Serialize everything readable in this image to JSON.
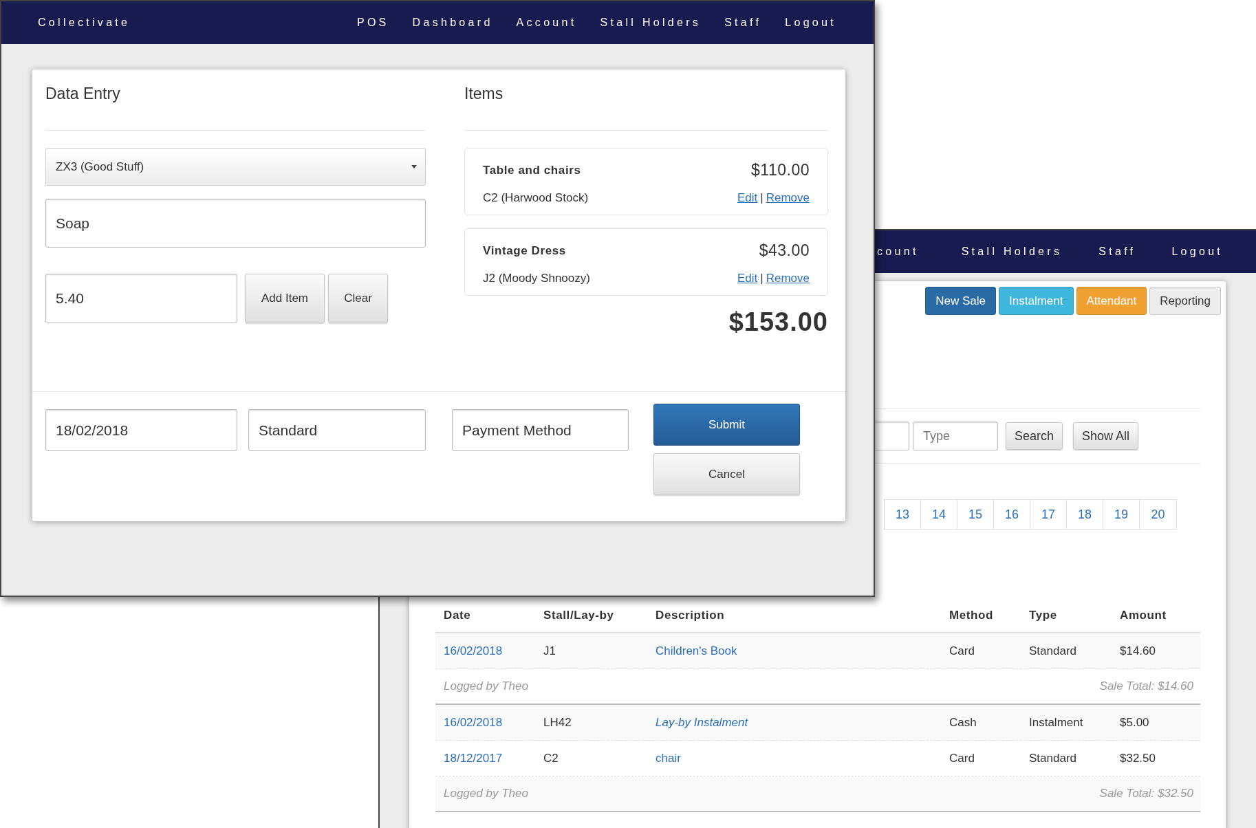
{
  "front_window": {
    "nav": {
      "brand": "Collectivate",
      "links": [
        "POS",
        "Dashboard",
        "Account",
        "Stall Holders",
        "Staff",
        "Logout"
      ]
    },
    "data_entry": {
      "heading": "Data Entry",
      "stall_select": "ZX3 (Good Stuff)",
      "description_value": "Soap",
      "price_value": "5.40",
      "buttons": [
        "Add Item",
        "Clear"
      ]
    },
    "items": {
      "heading": "Items",
      "list": [
        {
          "name": "Table and chairs",
          "price": "$110.00",
          "stall": "C2 (Harwood Stock)",
          "edit": "Edit",
          "separator": "|",
          "remove": "Remove"
        },
        {
          "name": "Vintage Dress",
          "price": "$43.00",
          "stall": "J2 (Moody Shnoozy)",
          "edit": "Edit",
          "separator": "|",
          "remove": "Remove"
        }
      ],
      "total": "$153.00"
    },
    "footer": {
      "date_value": "18/02/2018",
      "type_value": "Standard",
      "payment_value": "Payment Method",
      "submit": "Submit",
      "cancel": "Cancel"
    }
  },
  "back_window": {
    "nav": {
      "links": [
        "count",
        "Stall Holders",
        "Staff",
        "Logout"
      ]
    },
    "mode_buttons": [
      {
        "label": "New Sale",
        "color": "#2a6aa5"
      },
      {
        "label": "Instalment",
        "color": "#3fb6dc"
      },
      {
        "label": "Attendant",
        "color": "#f0a132"
      },
      {
        "label": "Reporting",
        "color": "#ececec"
      }
    ],
    "search": {
      "type_placeholder": "Type",
      "buttons": [
        "Search",
        "Show All"
      ]
    },
    "pagination": [
      "13",
      "14",
      "15",
      "16",
      "17",
      "18",
      "19",
      "20"
    ],
    "table": {
      "columns": [
        "Date",
        "Stall/Lay-by",
        "Description",
        "Method",
        "Type",
        "Amount"
      ],
      "rows": [
        {
          "kind": "sale",
          "date": "16/02/2018",
          "stall": "J1",
          "description": "Children's Book",
          "italic": false,
          "method": "Card",
          "type": "Standard",
          "amount": "$14.60"
        },
        {
          "kind": "summary",
          "logged": "Logged by Theo",
          "total": "Sale Total: $14.60"
        },
        {
          "kind": "sale",
          "date": "16/02/2018",
          "stall": "LH42",
          "description": "Lay-by Instalment",
          "italic": true,
          "method": "Cash",
          "type": "Instalment",
          "amount": "$5.00"
        },
        {
          "kind": "sale",
          "date": "18/12/2017",
          "stall": "C2",
          "description": "chair",
          "italic": false,
          "method": "Card",
          "type": "Standard",
          "amount": "$32.50"
        },
        {
          "kind": "summary",
          "logged": "Logged by Theo",
          "total": "Sale Total: $32.50"
        }
      ]
    }
  }
}
